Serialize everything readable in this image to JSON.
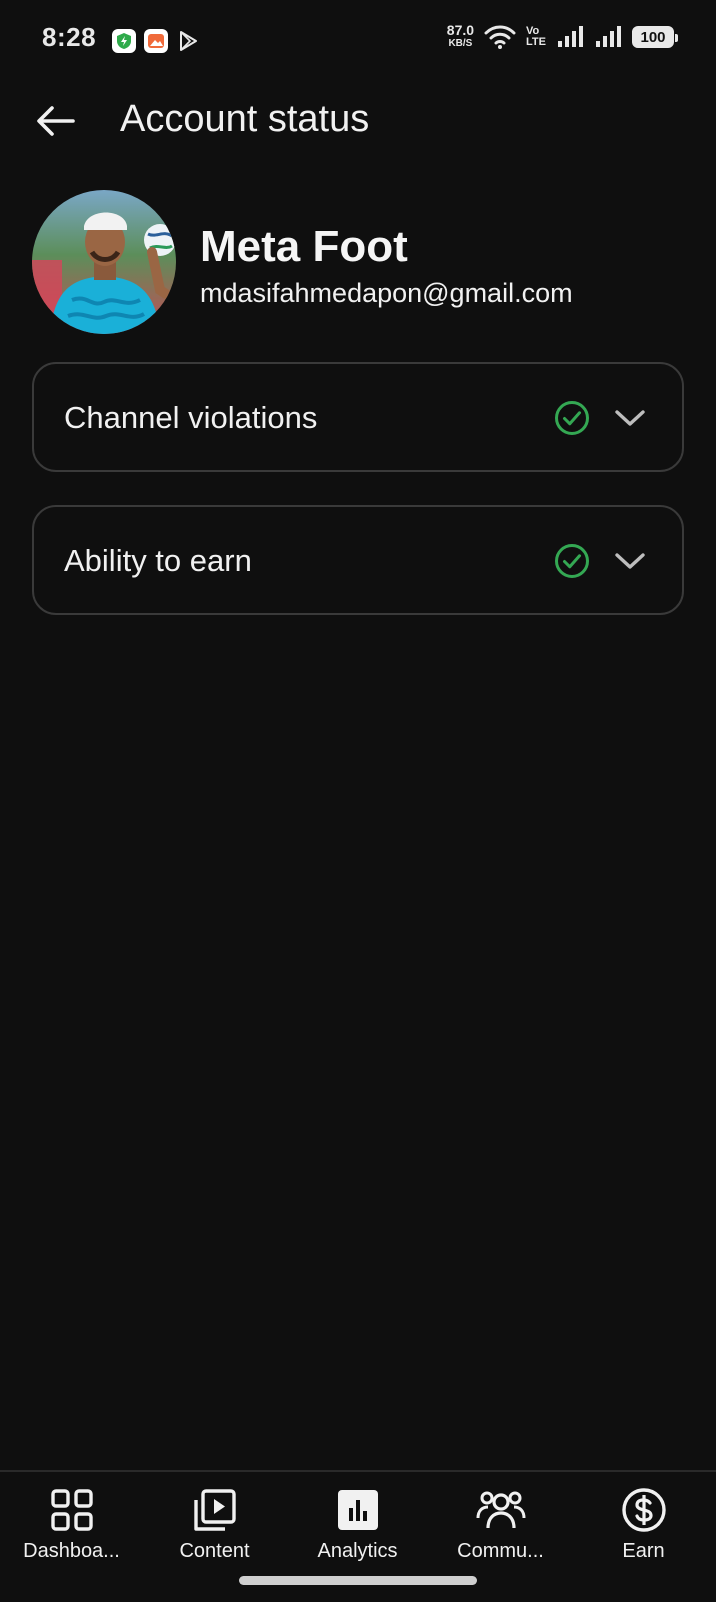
{
  "status_bar": {
    "time": "8:28",
    "network_speed": "87.0",
    "network_speed_unit": "KB/S",
    "volte_top": "Vo",
    "volte_bottom": "LTE",
    "battery": "100",
    "app_icons": [
      "shield-bolt-icon",
      "image-app-icon",
      "play-store-icon"
    ]
  },
  "header": {
    "title": "Account status",
    "back_icon": "arrow-left-icon"
  },
  "profile": {
    "name": "Meta Foot",
    "email": "mdasifahmedapon@gmail.com"
  },
  "cards": [
    {
      "label": "Channel violations",
      "status_icon": "check-circle-icon",
      "expand_icon": "chevron-down-icon"
    },
    {
      "label": "Ability to earn",
      "status_icon": "check-circle-icon",
      "expand_icon": "chevron-down-icon"
    }
  ],
  "bottom_nav": {
    "items": [
      {
        "label": "Dashboa...",
        "icon": "dashboard-grid-icon",
        "selected": false
      },
      {
        "label": "Content",
        "icon": "content-play-icon",
        "selected": false
      },
      {
        "label": "Analytics",
        "icon": "analytics-bar-icon",
        "selected": true
      },
      {
        "label": "Commu...",
        "icon": "community-people-icon",
        "selected": false
      },
      {
        "label": "Earn",
        "icon": "earn-dollar-icon",
        "selected": false
      }
    ]
  },
  "colors": {
    "background": "#0f0f0f",
    "check_green": "#34a853",
    "card_border": "#3a3a3a",
    "text": "#f1f1f1"
  }
}
